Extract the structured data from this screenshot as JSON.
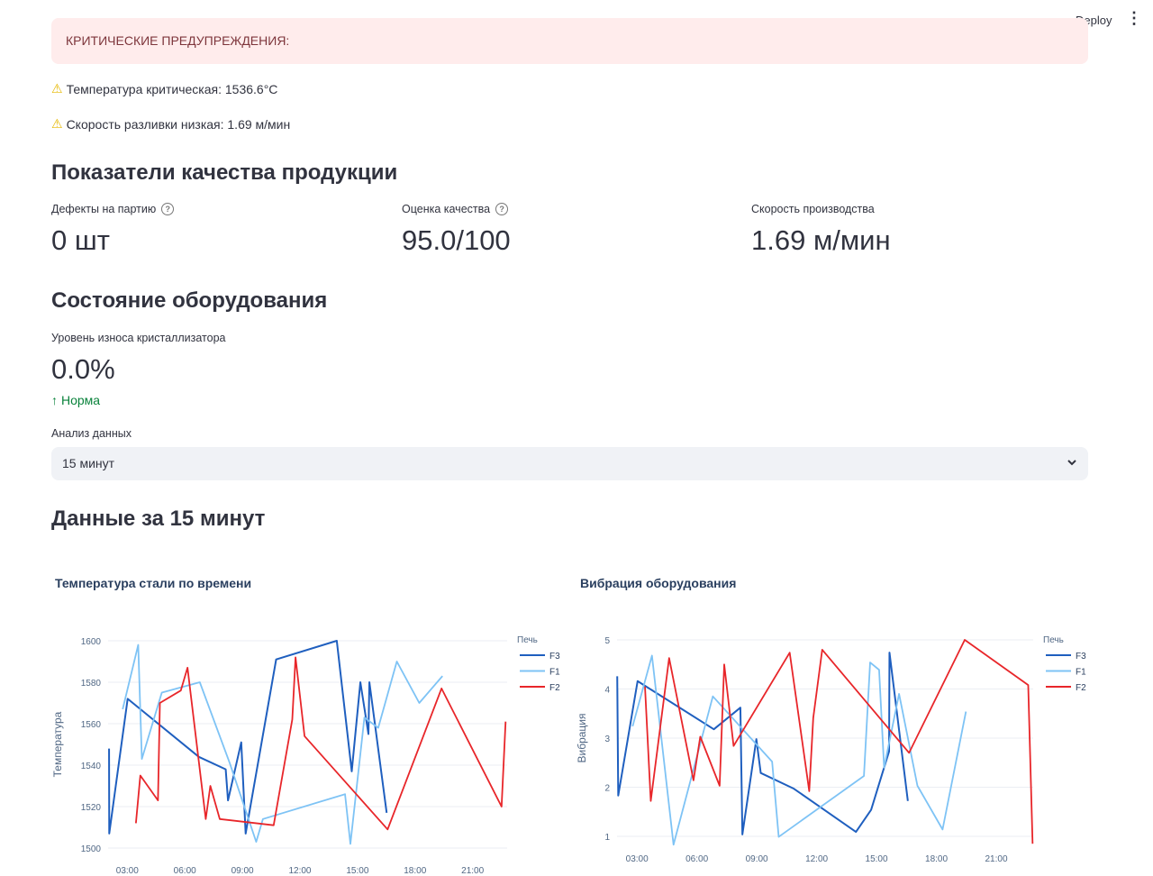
{
  "header": {
    "deploy_label": "Deploy",
    "menu_icon": "⋮"
  },
  "alerts": {
    "title": "КРИТИЧЕСКИЕ ПРЕДУПРЕЖДЕНИЯ:",
    "items": [
      "Температура критическая: 1536.6°C",
      "Скорость разливки низкая: 1.69 м/мин"
    ],
    "icon": "⚠"
  },
  "quality": {
    "heading": "Показатели качества продукции",
    "metrics": [
      {
        "label": "Дефекты на партию",
        "value": "0 шт",
        "help": "?"
      },
      {
        "label": "Оценка качества",
        "value": "95.0/100",
        "help": "?"
      },
      {
        "label": "Скорость производства",
        "value": "1.69 м/мин"
      }
    ]
  },
  "equipment": {
    "heading": "Состояние оборудования",
    "metric": {
      "label": "Уровень износа кристаллизатора",
      "value": "0.0%",
      "delta": "Норма",
      "delta_icon": "↑"
    }
  },
  "analysis": {
    "label": "Анализ данных",
    "selected": "15 минут"
  },
  "data_heading": "Данные за 15 минут",
  "colors": {
    "F3": "#1f5fbf",
    "F1": "#7ec3f5",
    "F2": "#e8262a"
  },
  "chart_data": [
    {
      "type": "line",
      "title": "Температура стали по времени",
      "xlabel": "",
      "ylabel": "Температура",
      "legend_title": "Печь",
      "legend": "top-right",
      "x_ticks": [
        "03:00",
        "06:00",
        "09:00",
        "12:00",
        "15:00",
        "18:00",
        "21:00"
      ],
      "x_tick_hours": [
        3,
        6,
        9,
        12,
        15,
        18,
        21
      ],
      "xlim_hours": [
        2,
        22.8
      ],
      "y_ticks": [
        1500,
        1520,
        1540,
        1560,
        1580,
        1600
      ],
      "ylim": [
        1500,
        1600
      ],
      "series": [
        {
          "name": "F3",
          "x": [
            2.05,
            2.06,
            3.02,
            6.73,
            8.13,
            8.25,
            8.94,
            9.17,
            10.76,
            13.92,
            14.7,
            15.15,
            15.57,
            15.62,
            16.52
          ],
          "y": [
            1548,
            1507,
            1572,
            1544,
            1538,
            1523,
            1551,
            1507,
            1591,
            1600,
            1537,
            1580,
            1555,
            1580,
            1517
          ]
        },
        {
          "name": "F1",
          "x": [
            2.76,
            3.57,
            3.76,
            4.8,
            6.78,
            8.34,
            9.72,
            10.07,
            14.35,
            14.63,
            15.36,
            16.08,
            17.05,
            18.22,
            19.43
          ],
          "y": [
            1567,
            1598,
            1543,
            1575,
            1580,
            1541,
            1503,
            1514,
            1526,
            1502,
            1563,
            1558,
            1590,
            1570,
            1583
          ]
        },
        {
          "name": "F2",
          "x": [
            3.45,
            3.68,
            4.6,
            4.7,
            5.79,
            6.14,
            7.09,
            7.33,
            7.82,
            10.63,
            11.6,
            11.77,
            12.24,
            16.57,
            19.38,
            22.51,
            22.72
          ],
          "y": [
            1512,
            1535,
            1523,
            1570,
            1576,
            1587,
            1514,
            1530,
            1514,
            1511,
            1562,
            1592,
            1554,
            1509,
            1577,
            1520,
            1561
          ]
        }
      ]
    },
    {
      "type": "line",
      "title": "Вибрация оборудования",
      "xlabel": "",
      "ylabel": "Вибрация",
      "legend_title": "Печь",
      "legend": "top-right",
      "x_ticks": [
        "03:00",
        "06:00",
        "09:00",
        "12:00",
        "15:00",
        "18:00",
        "21:00"
      ],
      "x_tick_hours": [
        3,
        6,
        9,
        12,
        15,
        18,
        21
      ],
      "xlim_hours": [
        2,
        22.85
      ],
      "y_ticks": [
        1,
        2,
        3,
        4,
        5
      ],
      "ylim": [
        1,
        5
      ],
      "series": [
        {
          "name": "F3",
          "x": [
            2.01,
            2.06,
            3.03,
            6.85,
            8.18,
            8.28,
            8.98,
            9.2,
            10.86,
            13.97,
            14.73,
            15.38,
            15.63,
            15.65,
            16.57
          ],
          "y": [
            4.26,
            1.83,
            4.16,
            3.18,
            3.62,
            1.04,
            2.98,
            2.29,
            1.97,
            1.09,
            1.54,
            2.4,
            2.73,
            4.74,
            1.72
          ]
        },
        {
          "name": "F1",
          "x": [
            2.78,
            3.75,
            4.83,
            6.8,
            9.77,
            10.1,
            14.37,
            14.68,
            15.13,
            15.38,
            16.13,
            17.05,
            18.31,
            19.48
          ],
          "y": [
            3.24,
            4.68,
            0.83,
            3.85,
            2.52,
            0.99,
            2.23,
            4.54,
            4.39,
            2.4,
            3.9,
            2.03,
            1.14,
            3.54
          ]
        },
        {
          "name": "F2",
          "x": [
            3.4,
            3.69,
            4.61,
            5.83,
            6.17,
            7.14,
            7.37,
            7.84,
            10.65,
            11.63,
            11.83,
            12.28,
            16.63,
            19.42,
            22.6,
            22.82
          ],
          "y": [
            4.05,
            1.72,
            4.63,
            2.14,
            3.03,
            2.03,
            4.5,
            2.84,
            4.74,
            1.92,
            3.41,
            4.8,
            2.7,
            5.0,
            4.08,
            0.85
          ]
        }
      ]
    }
  ]
}
